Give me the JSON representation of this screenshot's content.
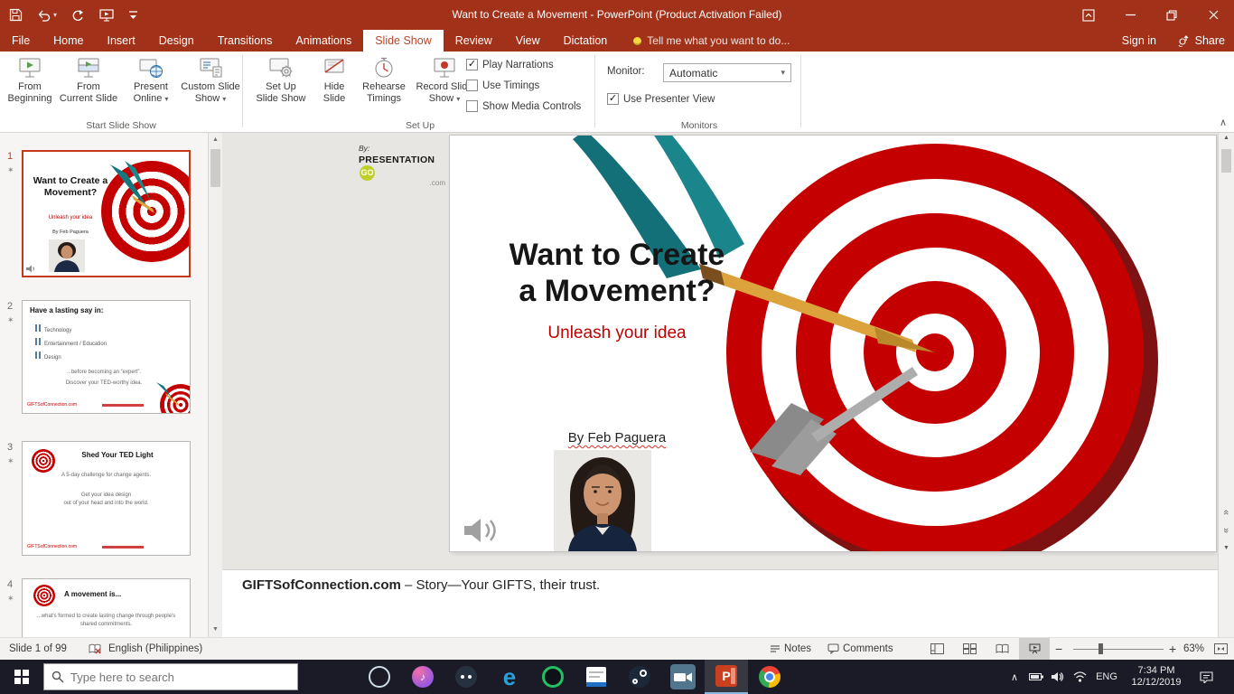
{
  "titlebar": {
    "title": "Want to Create a Movement - PowerPoint (Product Activation Failed)"
  },
  "tabs": {
    "file": "File",
    "home": "Home",
    "insert": "Insert",
    "design": "Design",
    "transitions": "Transitions",
    "animations": "Animations",
    "slide_show": "Slide Show",
    "review": "Review",
    "view": "View",
    "dictation": "Dictation",
    "tell_me": "Tell me what you want to do...",
    "sign_in": "Sign in",
    "share": "Share"
  },
  "ribbon": {
    "start": {
      "label": "Start Slide Show",
      "fb1": "From",
      "fb2": "Beginning",
      "fc1": "From",
      "fc2": "Current Slide",
      "po1": "Present",
      "po2": "Online",
      "cs1": "Custom Slide",
      "cs2": "Show"
    },
    "setup": {
      "label": "Set Up",
      "ss1": "Set Up",
      "ss2": "Slide Show",
      "hs1": "Hide",
      "hs2": "Slide",
      "rt1": "Rehearse",
      "rt2": "Timings",
      "rs1": "Record Slide",
      "rs2": "Show",
      "play_narrations": "Play Narrations",
      "use_timings": "Use Timings",
      "show_media": "Show Media Controls"
    },
    "monitors": {
      "label": "Monitors",
      "monitor_label": "Monitor:",
      "monitor_value": "Automatic",
      "presenter": "Use Presenter View"
    }
  },
  "thumbs": {
    "t1": {
      "num": "1",
      "title": "Want to Create a Movement?",
      "subtitle": "Unleash your idea",
      "byline": "By Feb Paguera"
    },
    "t2": {
      "num": "2",
      "title": "Have a lasting say in:",
      "b1": "Technology",
      "b2": "Entertainment / Education",
      "b3": "Design",
      "n1": "...before becoming an “expert”.",
      "n2": "Discover your TED-worthy idea.",
      "footer": "GIFTSofConnection.com"
    },
    "t3": {
      "num": "3",
      "title": "Shed Your TED Light",
      "l1": "A 5-day challenge for change agents.",
      "l2": "Get your idea design",
      "l3": "out of your head and into the world.",
      "footer": "GIFTSofConnection.com"
    },
    "t4": {
      "num": "4",
      "title": "A movement is...",
      "l1": "...what's formed to create lasting change through people's",
      "l2": "shared commitments."
    }
  },
  "slide": {
    "logo_by": "By:",
    "logo_name": "PRESENTATION",
    "logo_go": "GO",
    "logo_com": ".com",
    "title1": "Want to Create",
    "title2": "a Movement?",
    "subtitle": "Unleash your idea",
    "byline": "By Feb Paguera"
  },
  "notes": {
    "lead": "GIFTSofConnection.com",
    "rest": " – Story—Your GIFTS, their trust."
  },
  "status": {
    "slide_info": "Slide 1 of 99",
    "language": "English (Philippines)",
    "notes_label": "Notes",
    "comments_label": "Comments",
    "zoom_level": "63%"
  },
  "taskbar": {
    "search_placeholder": "Type here to search",
    "lang": "ENG",
    "time": "7:34 PM",
    "date": "12/12/2019"
  },
  "icons": {
    "caret_down": "▾",
    "caret_up": "∧",
    "arrow_up": "▲",
    "arrow_down": "▼",
    "chevrons_prev": "«",
    "chevrons_next": "»",
    "checkmark": "✓",
    "star": "✶",
    "minus": "−",
    "plus": "+",
    "music_note": "♪",
    "edge_e": "e",
    "ppt_p": "P"
  }
}
